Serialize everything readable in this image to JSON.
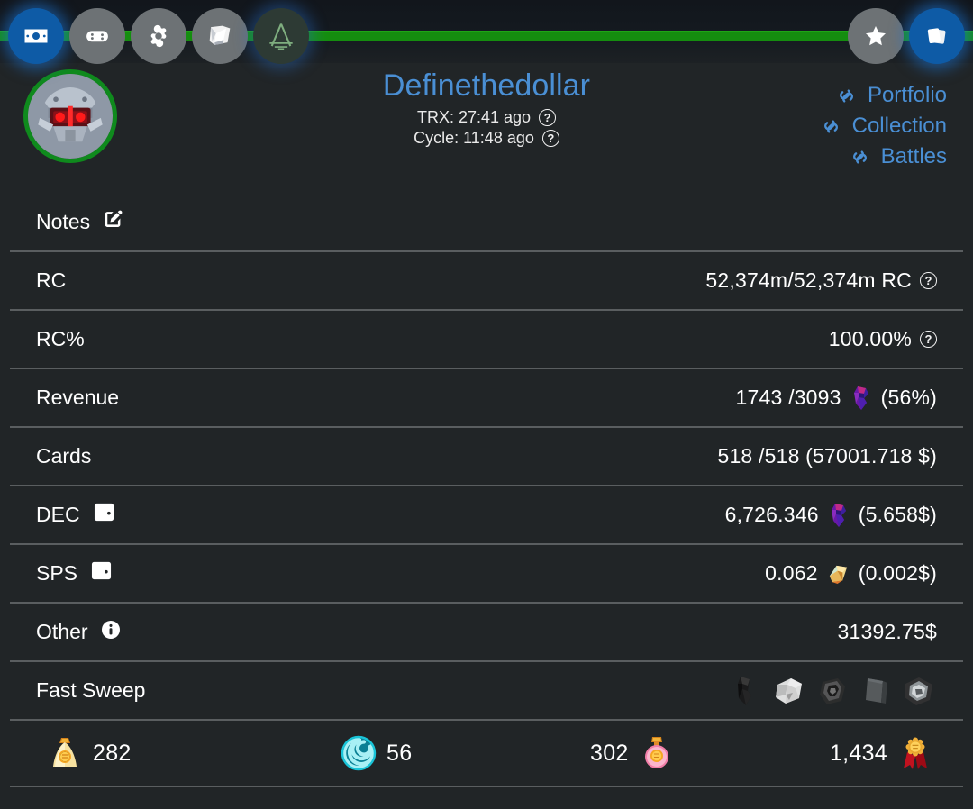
{
  "theme": {
    "bg": "#212527",
    "accent_blue": "#4a8fd4",
    "rail_green": "#158d0f",
    "divider": "#5a5e60",
    "nav_active": "#0e5ba6",
    "nav_inactive": "#6d7275",
    "avatar_ring": "#0f8a1d"
  },
  "topnav": {
    "left_items": [
      {
        "name": "money-icon",
        "label": "Money",
        "state": "active"
      },
      {
        "name": "gamepad-icon",
        "label": "Gamepad",
        "state": "inactive"
      },
      {
        "name": "gear-icon",
        "label": "Settings",
        "state": "inactive"
      },
      {
        "name": "scroll-icon",
        "label": "Scroll",
        "state": "inactive"
      },
      {
        "name": "letter-a-icon",
        "label": "A",
        "state": "glow"
      }
    ],
    "right_items": [
      {
        "name": "star-icon",
        "label": "Star",
        "state": "inactive"
      },
      {
        "name": "cards-icon",
        "label": "Cards",
        "state": "active"
      }
    ]
  },
  "profile": {
    "avatar_name": "robot-avatar",
    "account_name": "Definethedollar",
    "trx_label": "TRX: 27:41 ago",
    "cycle_label": "Cycle: 11:48 ago",
    "help_glyph": "?",
    "links": [
      {
        "label": "Portfolio"
      },
      {
        "label": "Collection"
      },
      {
        "label": "Battles"
      }
    ]
  },
  "rows": [
    {
      "label": "Notes",
      "icon": "edit-icon",
      "value": "",
      "help": false
    },
    {
      "label": "RC",
      "icon": null,
      "value": "52,374m/52,374m RC",
      "help": true
    },
    {
      "label": "RC%",
      "icon": null,
      "value": "100.00%",
      "help": true
    },
    {
      "label": "Revenue",
      "icon": null,
      "value_pre": "1743 /3093",
      "gem": "dec-crystal-icon",
      "value_post": "(56%)"
    },
    {
      "label": "Cards",
      "icon": null,
      "value": "518 /518 (57001.718 $)",
      "help": false
    },
    {
      "label": "DEC",
      "icon": "wallet-icon",
      "value_pre": "6,726.346",
      "gem": "dec-crystal-icon",
      "value_post": "(5.658$)"
    },
    {
      "label": "SPS",
      "icon": "wallet-icon",
      "value_pre": "0.062",
      "gem": "sps-gem-icon",
      "value_post": "(0.002$)"
    },
    {
      "label": "Other",
      "icon": "info-icon",
      "value": "31392.75$",
      "help": false
    },
    {
      "label": "Fast Sweep",
      "icon": null,
      "sweep_icons": [
        "sweep-item-1-icon",
        "sweep-item-2-icon",
        "sweep-item-3-icon",
        "sweep-item-4-icon",
        "sweep-item-5-icon"
      ]
    }
  ],
  "row_labels": {
    "notes": "Notes",
    "rc": "RC",
    "rc_pct": "RC%",
    "revenue": "Revenue",
    "cards": "Cards",
    "dec": "DEC",
    "sps": "SPS",
    "other": "Other",
    "fast_sweep": "Fast Sweep"
  },
  "row_values": {
    "rc": "52,374m/52,374m RC",
    "rc_pct": "100.00%",
    "revenue_pre": "1743 /3093",
    "revenue_post": "(56%)",
    "cards": "518 /518 (57001.718 $)",
    "dec_pre": "6,726.346",
    "dec_post": "(5.658$)",
    "sps_pre": "0.062",
    "sps_post": "(0.002$)",
    "other": "31392.75$"
  },
  "resources": [
    {
      "icon": "gold-bag-icon",
      "value": "282",
      "order": "icon-first"
    },
    {
      "icon": "cyan-spiral-icon",
      "value": "56",
      "order": "icon-first"
    },
    {
      "icon": "potion-icon",
      "value": "302",
      "order": "value-first"
    },
    {
      "icon": "medal-icon",
      "value": "1,434",
      "order": "value-first"
    }
  ],
  "resource_values": {
    "gold": "282",
    "spiral": "56",
    "potion": "302",
    "medal": "1,434"
  }
}
